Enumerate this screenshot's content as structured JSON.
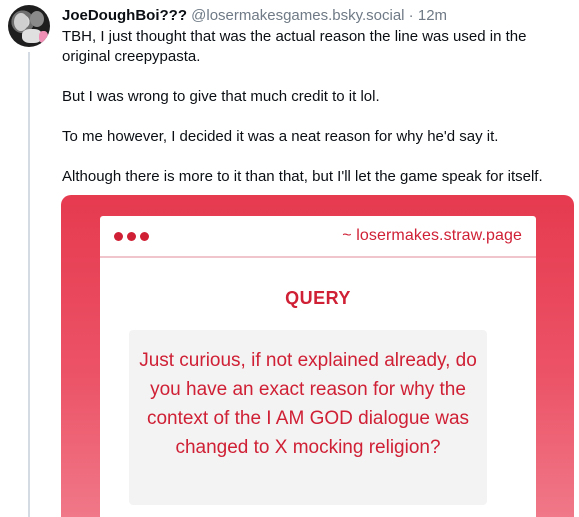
{
  "post": {
    "author_name": "JoeDoughBoi???",
    "handle": "@losermakesgames.bsky.social",
    "separator": " · ",
    "time": "12m",
    "paragraphs": [
      "TBH, I just thought that was the actual reason the line was used in the original creepypasta.",
      "But I was wrong to give that much credit to it lol.",
      "To me however, I decided it was a neat reason for why he'd say it.",
      "Although there is more to it than that, but I'll let the game speak for itself."
    ]
  },
  "embed": {
    "url": "~ losermakes.straw.page",
    "heading": "QUERY",
    "question": "Just curious, if not explained already, do you have an exact reason for why the context of the I AM GOD dialogue was changed to X mocking religion?",
    "colors": {
      "accent": "#cf2035",
      "background": "#e63a4f"
    }
  }
}
